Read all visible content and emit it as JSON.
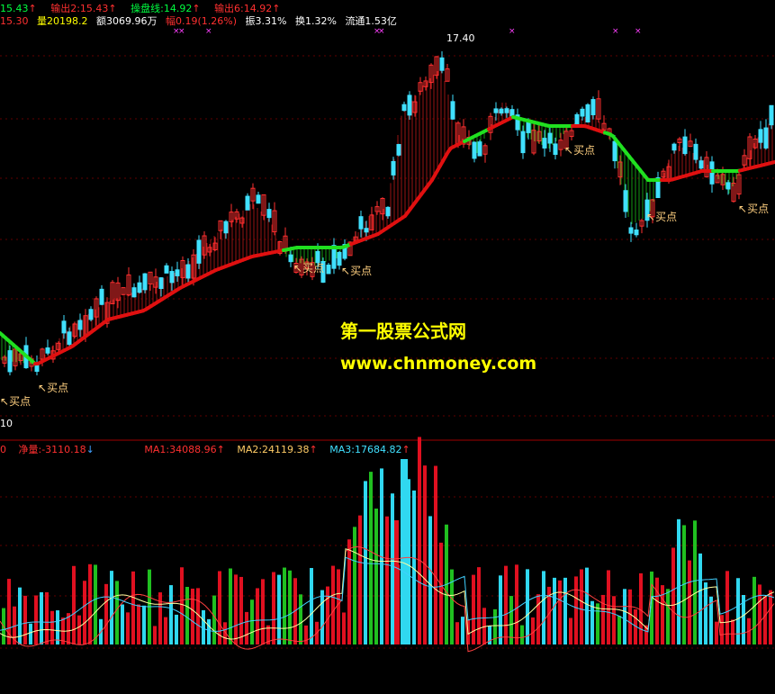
{
  "info_row1": {
    "price_left": "15.43",
    "output2": "输出2:15.43",
    "caopan": "操盘线:14.92",
    "output6": "输出6:14.92"
  },
  "info_row2": {
    "open": "15.30",
    "volume": "量20198.2",
    "amount": "额3069.96万",
    "change": "幅0.19(1.26%)",
    "amplitude": "振3.31%",
    "turnover": "换1.32%",
    "float": "流通1.53亿"
  },
  "peak_label": "17.40",
  "left_scale_label": "10",
  "buy_points": [
    "买点",
    "买点",
    "买点",
    "买点",
    "买点",
    "买点"
  ],
  "watermark": {
    "line1": "第一股票公式网",
    "line2": "www.chnmoney.com"
  },
  "indicator_row": {
    "net_label": "净量:-3110.18",
    "ma1": "MA1:34088.96",
    "ma2": "MA2:24119.38",
    "ma3": "MA3:17684.82"
  },
  "colors": {
    "background": "#000000",
    "up_candle": "#ff3030",
    "down_candle": "#40e0ff",
    "ma_line_up": "#e01010",
    "ma_line_down": "#20e020",
    "divider": "#a00000"
  }
}
